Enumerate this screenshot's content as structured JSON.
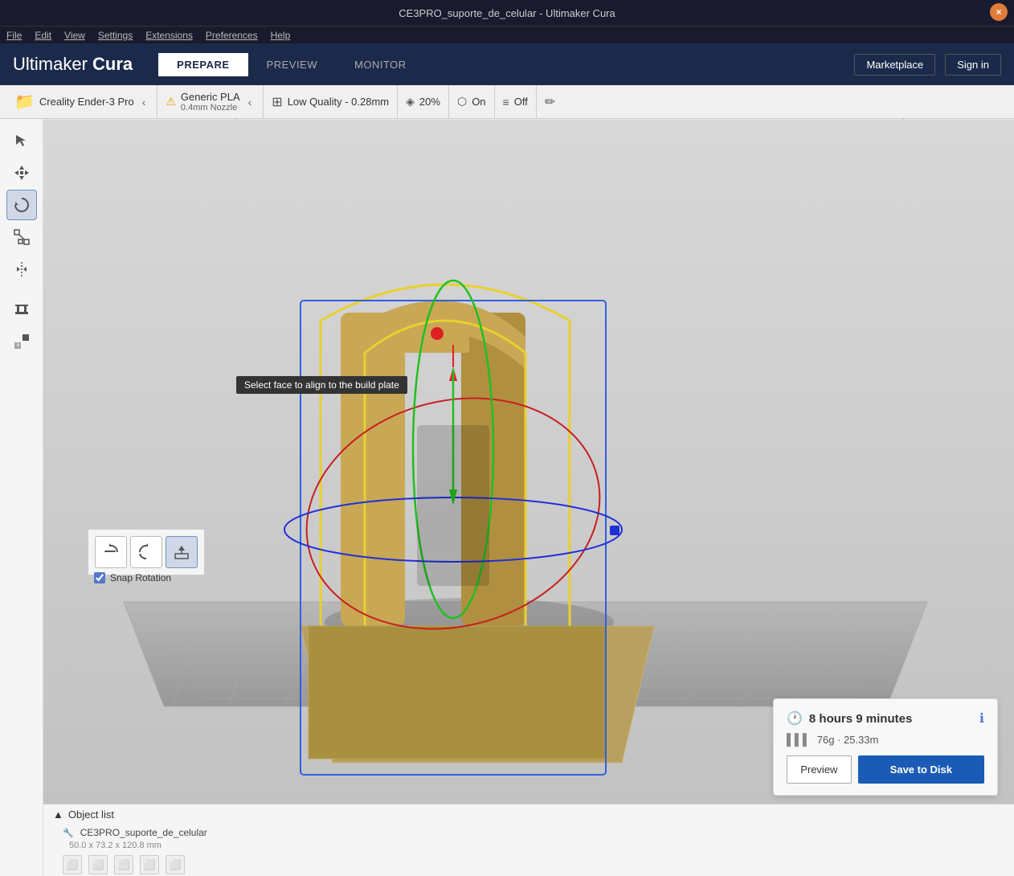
{
  "titleBar": {
    "title": "CE3PRO_suporte_de_celular - Ultimaker Cura",
    "closeLabel": "×"
  },
  "menuBar": {
    "items": [
      "File",
      "Edit",
      "View",
      "Settings",
      "Extensions",
      "Preferences",
      "Help"
    ]
  },
  "topNav": {
    "brand": "Ultimaker",
    "brandBold": "Cura",
    "tabs": [
      {
        "label": "PREPARE",
        "active": true
      },
      {
        "label": "PREVIEW",
        "active": false
      },
      {
        "label": "MONITOR",
        "active": false
      }
    ],
    "marketplaceLabel": "Marketplace",
    "signinLabel": "Sign in"
  },
  "toolbar": {
    "printerName": "Creality Ender-3 Pro",
    "materialName": "Generic PLA",
    "materialSub": "0.4mm Nozzle",
    "qualityName": "Low Quality - 0.28mm",
    "infillValue": "20%",
    "supportValue": "On",
    "adhesionValue": "Off"
  },
  "rotationSubtoolbar": {
    "buttons": [
      "↻",
      "↺",
      "⟲"
    ],
    "snapLabel": "Snap Rotation",
    "tooltip": "Select face to align to the build plate"
  },
  "objectList": {
    "header": "Object list",
    "items": [
      {
        "name": "CE3PRO_suporte_de_celular",
        "dimensions": "50.0 x 73.2 x 120.8 mm"
      }
    ],
    "iconLabels": [
      "□",
      "□",
      "□",
      "□",
      "□"
    ]
  },
  "printInfo": {
    "timeLabel": "8 hours 9 minutes",
    "materialLabel": "76g · 25.33m",
    "previewBtn": "Preview",
    "saveBtn": "Save to Disk"
  },
  "icons": {
    "clockIcon": "🕐",
    "barCodeIcon": "▌▌▌",
    "infoIcon": "ℹ"
  }
}
